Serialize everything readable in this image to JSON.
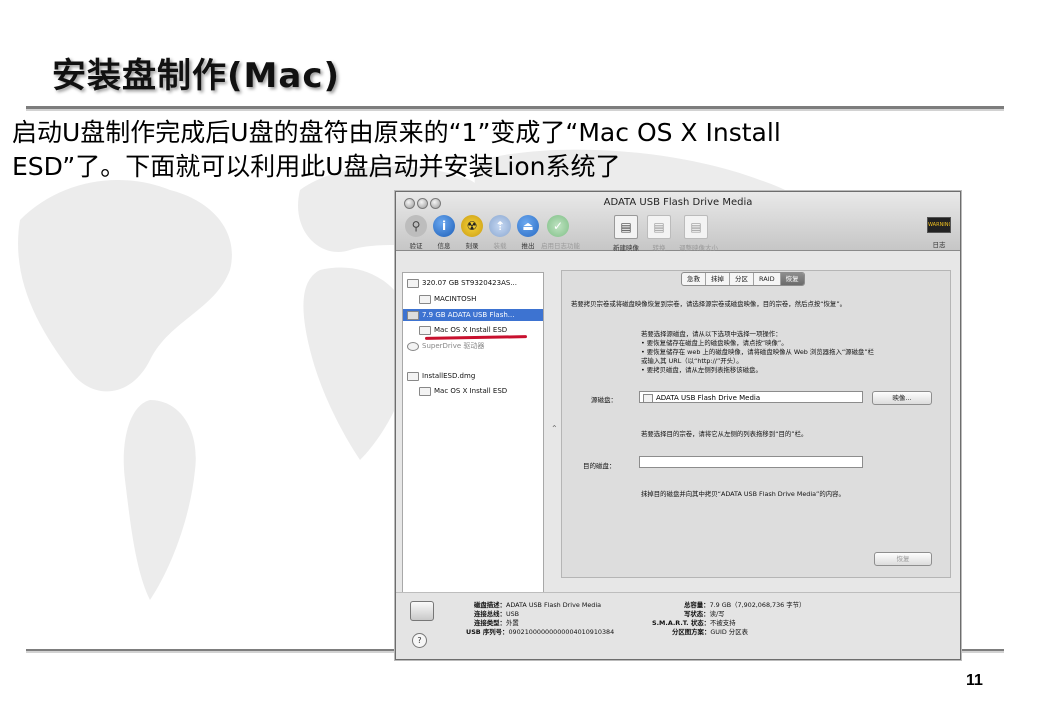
{
  "slide": {
    "title": "安装盘制作(Mac)",
    "body_line1": "启动U盘制作完成后U盘的盘符由原来的“1”变成了“Mac OS X Install",
    "body_line2": "ESD”了。下面就可以利用此U盘启动并安装Lion系统了",
    "page_number": "11"
  },
  "window": {
    "title": "ADATA USB Flash Drive Media",
    "toolbar": [
      {
        "label": "验证",
        "icon": "microscope-icon"
      },
      {
        "label": "信息",
        "icon": "info-icon"
      },
      {
        "label": "刻录",
        "icon": "burn-icon"
      },
      {
        "label": "装载",
        "icon": "mount-icon"
      },
      {
        "label": "推出",
        "icon": "eject-icon"
      },
      {
        "label": "启用日志功能",
        "icon": "journal-icon"
      },
      {
        "label": "新建映像",
        "icon": "new-image-icon"
      },
      {
        "label": "转换",
        "icon": "convert-icon"
      },
      {
        "label": "调整映像大小",
        "icon": "resize-image-icon"
      }
    ],
    "log_label": "日志",
    "log_icon_text": "WARNING",
    "sidebar": [
      {
        "label": "320.07 GB ST9320423AS..."
      },
      {
        "label": "MACINTOSH"
      },
      {
        "label": "7.9 GB ADATA USB Flash..."
      },
      {
        "label": "Mac OS X Install ESD"
      },
      {
        "label": "SuperDrive 驱动器"
      },
      {
        "label": "InstallESD.dmg"
      },
      {
        "label": "Mac OS X Install ESD"
      }
    ],
    "tabs": [
      "急救",
      "抹掉",
      "分区",
      "RAID",
      "恢复"
    ],
    "restore": {
      "intro": "若要拷贝宗卷或将磁盘映像恢复到宗卷，请选择源宗卷或磁盘映像，目的宗卷，然后点按“恢复”。",
      "choose_source": "若要选择源磁盘，请从以下选项中选择一项操作：",
      "bullets": [
        "• 要恢复储存在磁盘上的磁盘映像，请点按“映像”。",
        "• 要恢复储存在 web 上的磁盘映像，请将磁盘映像从 Web 浏览器拖入“源磁盘”栏",
        "  或输入其 URL（以“http://”开头）。",
        "• 要拷贝磁盘，请从左侧列表拖移该磁盘。"
      ],
      "source_label": "源磁盘：",
      "source_value": "ADATA USB Flash Drive Media",
      "image_button": "映像...",
      "dest_hint": "若要选择目的宗卷，请将它从左侧的列表拖移到“目的”栏。",
      "dest_label": "目的磁盘：",
      "dest_value": "",
      "erase_note": "抹掉目的磁盘并向其中拷贝“ADATA USB Flash Drive Media”的内容。",
      "restore_button": "恢复"
    },
    "info": {
      "left": [
        {
          "k": "磁盘描述：",
          "v": "ADATA USB Flash Drive Media"
        },
        {
          "k": "连接总线：",
          "v": "USB"
        },
        {
          "k": "连接类型：",
          "v": "外置"
        },
        {
          "k": "USB 序列号：",
          "v": "09021000000000004010910384"
        }
      ],
      "right": [
        {
          "k": "总容量：",
          "v": "7.9 GB（7,902,068,736 字节）"
        },
        {
          "k": "写状态：",
          "v": "读/写"
        },
        {
          "k": "S.M.A.R.T. 状态：",
          "v": "不被支持"
        },
        {
          "k": "分区图方案：",
          "v": "GUID 分区表"
        }
      ]
    },
    "help_glyph": "?"
  }
}
